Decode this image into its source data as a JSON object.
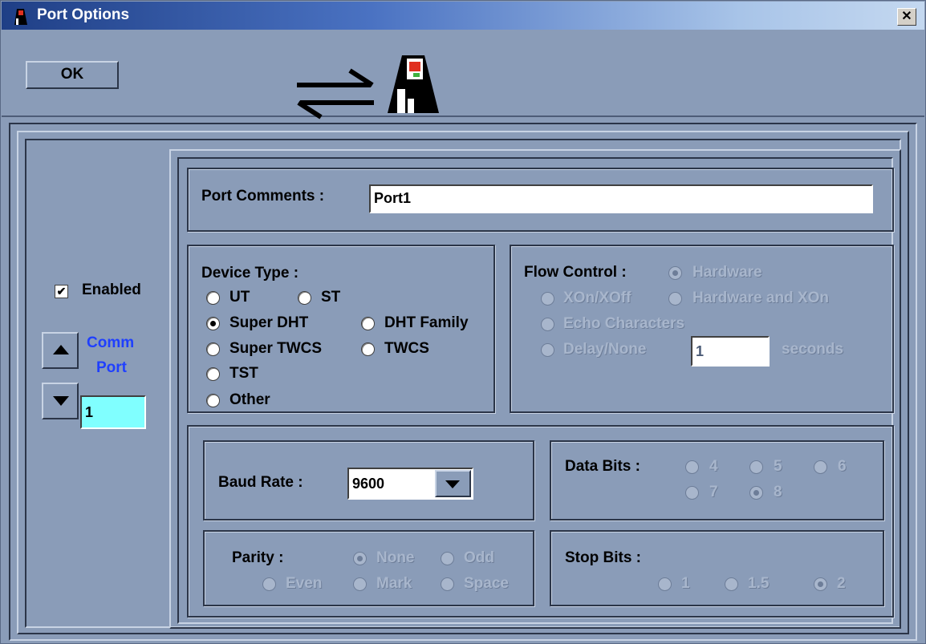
{
  "window": {
    "title": "Port Options",
    "close_label": "✕"
  },
  "toolbar": {
    "ok_label": "OK"
  },
  "sidebar": {
    "enabled_label": "Enabled",
    "enabled_checked": true,
    "comm_port_line1": "Comm",
    "comm_port_line2": "Port",
    "comm_port_value": "1"
  },
  "port_comments": {
    "label": "Port Comments :",
    "value": "Port1"
  },
  "device_type": {
    "label": "Device Type :",
    "options": [
      "UT",
      "ST",
      "Super DHT",
      "DHT Family",
      "Super TWCS",
      "TWCS",
      "TST",
      "Other"
    ],
    "selected": "Super DHT"
  },
  "flow_control": {
    "label": "Flow Control :",
    "options": [
      "Hardware",
      "XOn/XOff",
      "Hardware and XOn",
      "Echo Characters",
      "Delay/None"
    ],
    "selected": "Hardware",
    "delay_value": "1",
    "seconds_label": "seconds"
  },
  "baud_rate": {
    "label": "Baud Rate :",
    "value": "9600"
  },
  "data_bits": {
    "label": "Data Bits :",
    "options": [
      "4",
      "5",
      "6",
      "7",
      "8"
    ],
    "selected": "8"
  },
  "parity": {
    "label": "Parity :",
    "options": [
      "None",
      "Odd",
      "Even",
      "Mark",
      "Space"
    ],
    "selected": "None"
  },
  "stop_bits": {
    "label": "Stop Bits :",
    "options": [
      "1",
      "1.5",
      "2"
    ],
    "selected": "2"
  },
  "colors": {
    "background": "#8a9cb8",
    "title_gradient_start": "#1f3f86",
    "comm_port_text": "#1f3fff",
    "comm_port_field": "#80ffff"
  }
}
